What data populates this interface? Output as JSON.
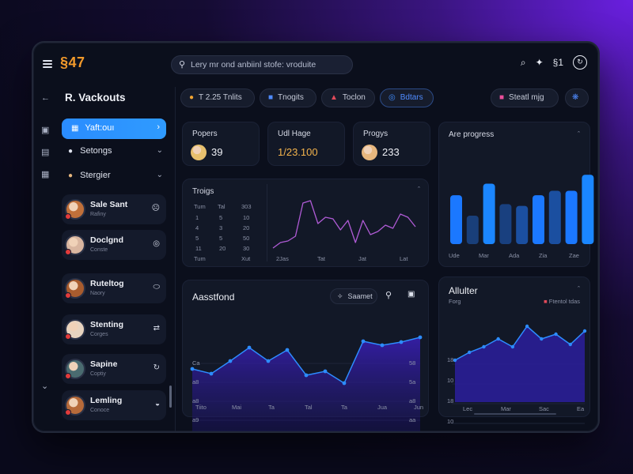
{
  "app": {
    "logo": "§47"
  },
  "search": {
    "text": "Lery mr ond anbiinl stofe: vroduite"
  },
  "topbar": {
    "icon1": "⌕",
    "icon2": "✦",
    "badge": "§1",
    "icon3": "↻"
  },
  "sidebar": {
    "title": "R. Vackouts",
    "active_item": "Yaft:ouı",
    "items": [
      {
        "label": "Setongs"
      },
      {
        "label": "Stergier"
      }
    ],
    "people": [
      {
        "name": "Sale Sant",
        "sub": "Rafiny",
        "action": "☹",
        "color": "#c0703a"
      },
      {
        "name": "Doclgnd",
        "sub": "Conste",
        "action": "◎",
        "color": "#d9b6a0"
      },
      {
        "name": "Ruteltog",
        "sub": "Naory",
        "action": "⬭",
        "color": "#a85c2e"
      },
      {
        "name": "Stenting",
        "sub": "Corges",
        "action": "⇄",
        "color": "#e8d4c0"
      },
      {
        "name": "Sapine",
        "sub": "Coptiy",
        "action": "↻",
        "color": "#4a6b70"
      },
      {
        "name": "Lemling",
        "sub": "Conoce",
        "action": "◒",
        "color": "#b66a3a"
      }
    ]
  },
  "filters": [
    {
      "label": "T 2.25 Tnlits",
      "icon": "●",
      "color": "#f1a431"
    },
    {
      "label": "Tnogits",
      "icon": "■",
      "color": "#4f8bff"
    },
    {
      "label": "Toclon",
      "icon": "▲",
      "color": "#e24a5a"
    },
    {
      "label": "Bdtars",
      "icon": "◎",
      "color": "#3f8cff"
    }
  ],
  "actions": {
    "profile": "Steatl mjg"
  },
  "stats": [
    {
      "label": "Popers",
      "value": "39",
      "color": "#e7c06e"
    },
    {
      "label": "Udl Hage",
      "value": "1/23.100",
      "color": ""
    },
    {
      "label": "Progys",
      "value": "233",
      "color": "#e7b77e"
    }
  ],
  "trends": {
    "title": "Troigs",
    "table": {
      "headers": [
        "Tum",
        "Tal",
        "303"
      ],
      "rows": [
        [
          "1",
          "5",
          "10"
        ],
        [
          "4",
          "3",
          "20"
        ],
        [
          "5",
          "5",
          "50"
        ],
        [
          "11",
          "20",
          "30"
        ]
      ],
      "footer": [
        "Tum",
        "Xut"
      ]
    },
    "xticks": [
      "2Jas",
      "Tat",
      "Jat",
      "Lat"
    ],
    "chart_data": {
      "type": "line",
      "x": [
        0,
        1,
        2,
        3,
        4,
        5,
        6,
        7,
        8,
        9,
        10,
        11,
        12,
        13,
        14,
        15,
        16,
        17,
        18,
        19
      ],
      "values": [
        5,
        12,
        14,
        20,
        62,
        65,
        36,
        44,
        42,
        28,
        40,
        12,
        40,
        22,
        26,
        34,
        30,
        48,
        44,
        32
      ]
    }
  },
  "progress": {
    "title": "Are progress",
    "xticks": [
      "Ude",
      "Mar",
      "Ada",
      "Zia",
      "Zae"
    ],
    "chart_data": {
      "type": "bar",
      "values": [
        55,
        32,
        68,
        45,
        43,
        55,
        60,
        60,
        78
      ],
      "colors": [
        "#1b78ff",
        "#193f7a",
        "#1b86ff",
        "#19407f",
        "#1b4fa0",
        "#1b78ff",
        "#1b4fa0",
        "#1b78ff",
        "#1a86ff"
      ]
    }
  },
  "analytics": {
    "title": "Aasstfond",
    "button": "Saamet",
    "yticks_left": [
      "Ca",
      "a8",
      "a8",
      "a9"
    ],
    "yticks_right": [
      "58",
      "5a",
      "a8",
      "aa"
    ],
    "xticks": [
      "Tiito",
      "Mai",
      "Ta",
      "Tal",
      "Ta",
      "Jua",
      "Jun"
    ],
    "chart_data": {
      "type": "area",
      "x": [
        0,
        1,
        2,
        3,
        4,
        5,
        6,
        7,
        8,
        9,
        10,
        11,
        12
      ],
      "values": [
        38,
        32,
        48,
        65,
        48,
        62,
        30,
        35,
        20,
        73,
        68,
        72,
        78
      ]
    }
  },
  "alluter": {
    "title": "Allulter",
    "sub": "Forg",
    "legend": "Ftentol tdas",
    "yticks": [
      "18",
      "10",
      "18",
      "10"
    ],
    "xticks": [
      "Lec",
      "Mar",
      "Sac",
      "Ea"
    ],
    "chart_data": {
      "type": "area",
      "x": [
        0,
        1,
        2,
        3,
        4,
        5,
        6,
        7,
        8,
        9
      ],
      "values": [
        45,
        55,
        62,
        72,
        62,
        88,
        72,
        78,
        65,
        82
      ]
    }
  }
}
